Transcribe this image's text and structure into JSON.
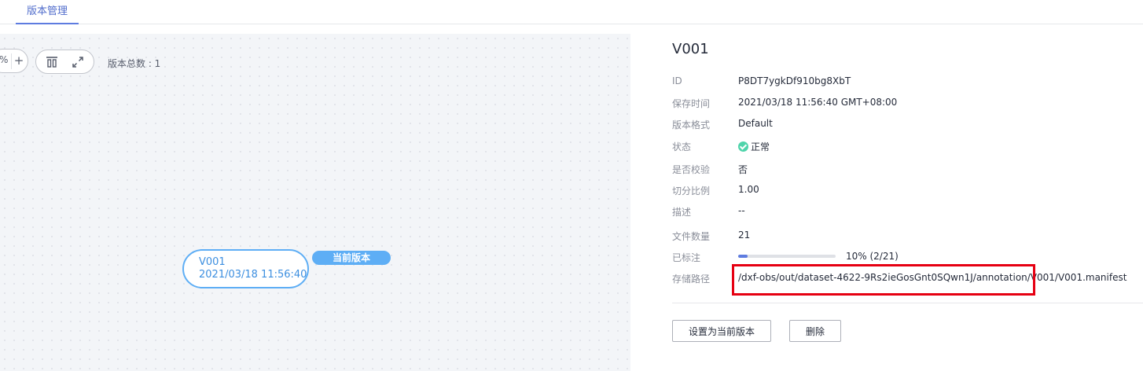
{
  "tabs": [
    {
      "label": "版本管理",
      "active": true
    }
  ],
  "toolbar": {
    "zoom_text": "%",
    "zoom_in_label": "+",
    "total_label": "版本总数 : 1"
  },
  "graph": {
    "node": {
      "name": "V001",
      "time": "2021/03/18 11:56:40"
    },
    "current_tag": "当前版本"
  },
  "detail": {
    "title": "V001",
    "fields": {
      "id": {
        "label": "ID",
        "value": "P8DT7ygkDf910bg8XbT"
      },
      "save_time": {
        "label": "保存时间",
        "value": "2021/03/18 11:56:40 GMT+08:00"
      },
      "format": {
        "label": "版本格式",
        "value": "Default"
      },
      "status": {
        "label": "状态",
        "value": "正常",
        "color": "#50d4ab"
      },
      "verified": {
        "label": "是否校验",
        "value": "否"
      },
      "split_ratio": {
        "label": "切分比例",
        "value": "1.00"
      },
      "description": {
        "label": "描述",
        "value": "--"
      },
      "file_count": {
        "label": "文件数量",
        "value": "21"
      },
      "labeled": {
        "label": "已标注",
        "value": "10% (2/21)",
        "progress_percent": 10
      },
      "storage_path": {
        "label": "存储路径",
        "value": "/dxf-obs/out/dataset-4622-9Rs2ieGosGnt0SQwn1J/annotation/V001/V001.manifest"
      }
    },
    "buttons": {
      "set_current": "设置为当前版本",
      "delete": "删除"
    }
  },
  "colors": {
    "accent": "#5e7ce0",
    "node_border": "#5eaef5",
    "highlight_box": "#e60012"
  }
}
